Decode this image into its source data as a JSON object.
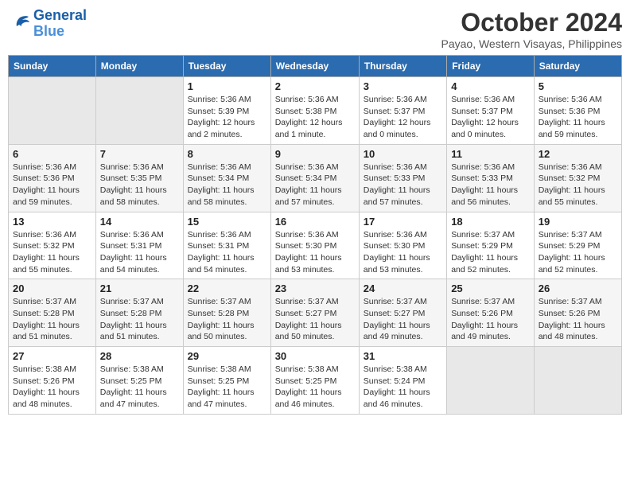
{
  "header": {
    "logo_line1": "General",
    "logo_line2": "Blue",
    "month": "October 2024",
    "location": "Payao, Western Visayas, Philippines"
  },
  "days_of_week": [
    "Sunday",
    "Monday",
    "Tuesday",
    "Wednesday",
    "Thursday",
    "Friday",
    "Saturday"
  ],
  "weeks": [
    [
      {
        "day": "",
        "empty": true
      },
      {
        "day": "",
        "empty": true
      },
      {
        "day": "1",
        "sunrise": "Sunrise: 5:36 AM",
        "sunset": "Sunset: 5:39 PM",
        "daylight": "Daylight: 12 hours and 2 minutes."
      },
      {
        "day": "2",
        "sunrise": "Sunrise: 5:36 AM",
        "sunset": "Sunset: 5:38 PM",
        "daylight": "Daylight: 12 hours and 1 minute."
      },
      {
        "day": "3",
        "sunrise": "Sunrise: 5:36 AM",
        "sunset": "Sunset: 5:37 PM",
        "daylight": "Daylight: 12 hours and 0 minutes."
      },
      {
        "day": "4",
        "sunrise": "Sunrise: 5:36 AM",
        "sunset": "Sunset: 5:37 PM",
        "daylight": "Daylight: 12 hours and 0 minutes."
      },
      {
        "day": "5",
        "sunrise": "Sunrise: 5:36 AM",
        "sunset": "Sunset: 5:36 PM",
        "daylight": "Daylight: 11 hours and 59 minutes."
      }
    ],
    [
      {
        "day": "6",
        "sunrise": "Sunrise: 5:36 AM",
        "sunset": "Sunset: 5:36 PM",
        "daylight": "Daylight: 11 hours and 59 minutes."
      },
      {
        "day": "7",
        "sunrise": "Sunrise: 5:36 AM",
        "sunset": "Sunset: 5:35 PM",
        "daylight": "Daylight: 11 hours and 58 minutes."
      },
      {
        "day": "8",
        "sunrise": "Sunrise: 5:36 AM",
        "sunset": "Sunset: 5:34 PM",
        "daylight": "Daylight: 11 hours and 58 minutes."
      },
      {
        "day": "9",
        "sunrise": "Sunrise: 5:36 AM",
        "sunset": "Sunset: 5:34 PM",
        "daylight": "Daylight: 11 hours and 57 minutes."
      },
      {
        "day": "10",
        "sunrise": "Sunrise: 5:36 AM",
        "sunset": "Sunset: 5:33 PM",
        "daylight": "Daylight: 11 hours and 57 minutes."
      },
      {
        "day": "11",
        "sunrise": "Sunrise: 5:36 AM",
        "sunset": "Sunset: 5:33 PM",
        "daylight": "Daylight: 11 hours and 56 minutes."
      },
      {
        "day": "12",
        "sunrise": "Sunrise: 5:36 AM",
        "sunset": "Sunset: 5:32 PM",
        "daylight": "Daylight: 11 hours and 55 minutes."
      }
    ],
    [
      {
        "day": "13",
        "sunrise": "Sunrise: 5:36 AM",
        "sunset": "Sunset: 5:32 PM",
        "daylight": "Daylight: 11 hours and 55 minutes."
      },
      {
        "day": "14",
        "sunrise": "Sunrise: 5:36 AM",
        "sunset": "Sunset: 5:31 PM",
        "daylight": "Daylight: 11 hours and 54 minutes."
      },
      {
        "day": "15",
        "sunrise": "Sunrise: 5:36 AM",
        "sunset": "Sunset: 5:31 PM",
        "daylight": "Daylight: 11 hours and 54 minutes."
      },
      {
        "day": "16",
        "sunrise": "Sunrise: 5:36 AM",
        "sunset": "Sunset: 5:30 PM",
        "daylight": "Daylight: 11 hours and 53 minutes."
      },
      {
        "day": "17",
        "sunrise": "Sunrise: 5:36 AM",
        "sunset": "Sunset: 5:30 PM",
        "daylight": "Daylight: 11 hours and 53 minutes."
      },
      {
        "day": "18",
        "sunrise": "Sunrise: 5:37 AM",
        "sunset": "Sunset: 5:29 PM",
        "daylight": "Daylight: 11 hours and 52 minutes."
      },
      {
        "day": "19",
        "sunrise": "Sunrise: 5:37 AM",
        "sunset": "Sunset: 5:29 PM",
        "daylight": "Daylight: 11 hours and 52 minutes."
      }
    ],
    [
      {
        "day": "20",
        "sunrise": "Sunrise: 5:37 AM",
        "sunset": "Sunset: 5:28 PM",
        "daylight": "Daylight: 11 hours and 51 minutes."
      },
      {
        "day": "21",
        "sunrise": "Sunrise: 5:37 AM",
        "sunset": "Sunset: 5:28 PM",
        "daylight": "Daylight: 11 hours and 51 minutes."
      },
      {
        "day": "22",
        "sunrise": "Sunrise: 5:37 AM",
        "sunset": "Sunset: 5:28 PM",
        "daylight": "Daylight: 11 hours and 50 minutes."
      },
      {
        "day": "23",
        "sunrise": "Sunrise: 5:37 AM",
        "sunset": "Sunset: 5:27 PM",
        "daylight": "Daylight: 11 hours and 50 minutes."
      },
      {
        "day": "24",
        "sunrise": "Sunrise: 5:37 AM",
        "sunset": "Sunset: 5:27 PM",
        "daylight": "Daylight: 11 hours and 49 minutes."
      },
      {
        "day": "25",
        "sunrise": "Sunrise: 5:37 AM",
        "sunset": "Sunset: 5:26 PM",
        "daylight": "Daylight: 11 hours and 49 minutes."
      },
      {
        "day": "26",
        "sunrise": "Sunrise: 5:37 AM",
        "sunset": "Sunset: 5:26 PM",
        "daylight": "Daylight: 11 hours and 48 minutes."
      }
    ],
    [
      {
        "day": "27",
        "sunrise": "Sunrise: 5:38 AM",
        "sunset": "Sunset: 5:26 PM",
        "daylight": "Daylight: 11 hours and 48 minutes."
      },
      {
        "day": "28",
        "sunrise": "Sunrise: 5:38 AM",
        "sunset": "Sunset: 5:25 PM",
        "daylight": "Daylight: 11 hours and 47 minutes."
      },
      {
        "day": "29",
        "sunrise": "Sunrise: 5:38 AM",
        "sunset": "Sunset: 5:25 PM",
        "daylight": "Daylight: 11 hours and 47 minutes."
      },
      {
        "day": "30",
        "sunrise": "Sunrise: 5:38 AM",
        "sunset": "Sunset: 5:25 PM",
        "daylight": "Daylight: 11 hours and 46 minutes."
      },
      {
        "day": "31",
        "sunrise": "Sunrise: 5:38 AM",
        "sunset": "Sunset: 5:24 PM",
        "daylight": "Daylight: 11 hours and 46 minutes."
      },
      {
        "day": "",
        "empty": true
      },
      {
        "day": "",
        "empty": true
      }
    ]
  ]
}
